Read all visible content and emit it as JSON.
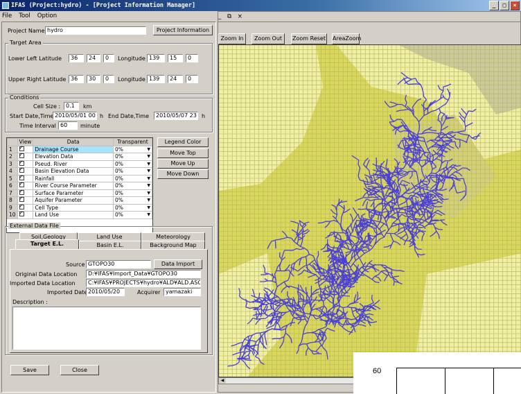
{
  "window": {
    "title": "IFAS (Project:hydro) - [Project Information Manager]",
    "controls": [
      "_",
      "□",
      "×"
    ]
  },
  "menu": {
    "items": [
      "File",
      "Tool",
      "Option"
    ],
    "mdi_controls": "_ ⧉ ×"
  },
  "project": {
    "name_label": "Project Name",
    "name_value": "hydro",
    "info_button": "Project Information"
  },
  "target_area": {
    "legend": "Target Area",
    "lower_left_label": "Lower Left Latitude",
    "lower_left_lat": [
      "36",
      "24",
      "0"
    ],
    "lower_left_lon_label": "Longitude",
    "lower_left_lon": [
      "139",
      "15",
      "0"
    ],
    "upper_right_label": "Upper Right Latitude",
    "upper_right_lat": [
      "36",
      "30",
      "0"
    ],
    "upper_right_lon_label": "Longitude",
    "upper_right_lon": [
      "139",
      "24",
      "0"
    ]
  },
  "conditions": {
    "legend": "Conditions",
    "cell_size_label": "Cell Size :",
    "cell_size": "0.1",
    "cell_unit": "km",
    "start_label": "Start Date,Time",
    "start": "2010/05/01 00",
    "start_unit": "h",
    "end_label": "End Date,Time",
    "end": "2010/05/07 23",
    "end_unit": "h",
    "interval_label": "Time Interval :",
    "interval": "60",
    "interval_unit": "minute"
  },
  "layers": {
    "headers": [
      "View",
      "Data",
      "Transparent"
    ],
    "rows": [
      {
        "n": "1",
        "data": "Drainage Course",
        "t": "0%"
      },
      {
        "n": "2",
        "data": "Elevation Data",
        "t": "0%"
      },
      {
        "n": "3",
        "data": "Pseud. River",
        "t": "0%"
      },
      {
        "n": "4",
        "data": "Basin Elevation Data",
        "t": "0%"
      },
      {
        "n": "5",
        "data": "Rainfall",
        "t": "0%"
      },
      {
        "n": "6",
        "data": "River Course Parameter",
        "t": "0%"
      },
      {
        "n": "7",
        "data": "Surface Parameter",
        "t": "0%"
      },
      {
        "n": "8",
        "data": "Aquifer Parameter",
        "t": "0%"
      },
      {
        "n": "9",
        "data": "Cell Type",
        "t": "0%"
      },
      {
        "n": "10",
        "data": "Land Use",
        "t": "0%"
      }
    ],
    "buttons": [
      "Legend Color",
      "Move Top",
      "Move Up",
      "Move Down"
    ]
  },
  "external": {
    "legend": "External Data File",
    "tabs_back": [
      "Soil,Geology",
      "Land Use",
      "Meteorology"
    ],
    "tabs_front": [
      "Target E.L.",
      "Basin E.L.",
      "Background Map"
    ],
    "source_label": "Source",
    "source": "GTOPO30",
    "import_button": "Data Import",
    "orig_label": "Original Data Location",
    "orig": "D:¥IFAS¥Import_Data¥GTOPO30",
    "imported_loc_label": "Imported Data Location",
    "imported_loc": "C:¥IFAS¥PROJECTS¥hydro¥ALD¥ALD.ASC",
    "date_label": "Imported Date",
    "date": "2010/05/20",
    "acquirer_label": "Acquirer",
    "acquirer": "yamazaki",
    "description_label": "Description :"
  },
  "footer": {
    "save": "Save",
    "close": "Close"
  },
  "map_toolbar": [
    "Zoom In",
    "Zoom Out",
    "Zoom Reset",
    "AreaZoom"
  ],
  "overlay_label": "60",
  "colors": {
    "map_bg": "#d9d75e",
    "map_light": "#f0efa8",
    "map_grey": "#cbc9a0",
    "river": "#4a3fd8",
    "grid_line": "#b8b650"
  }
}
